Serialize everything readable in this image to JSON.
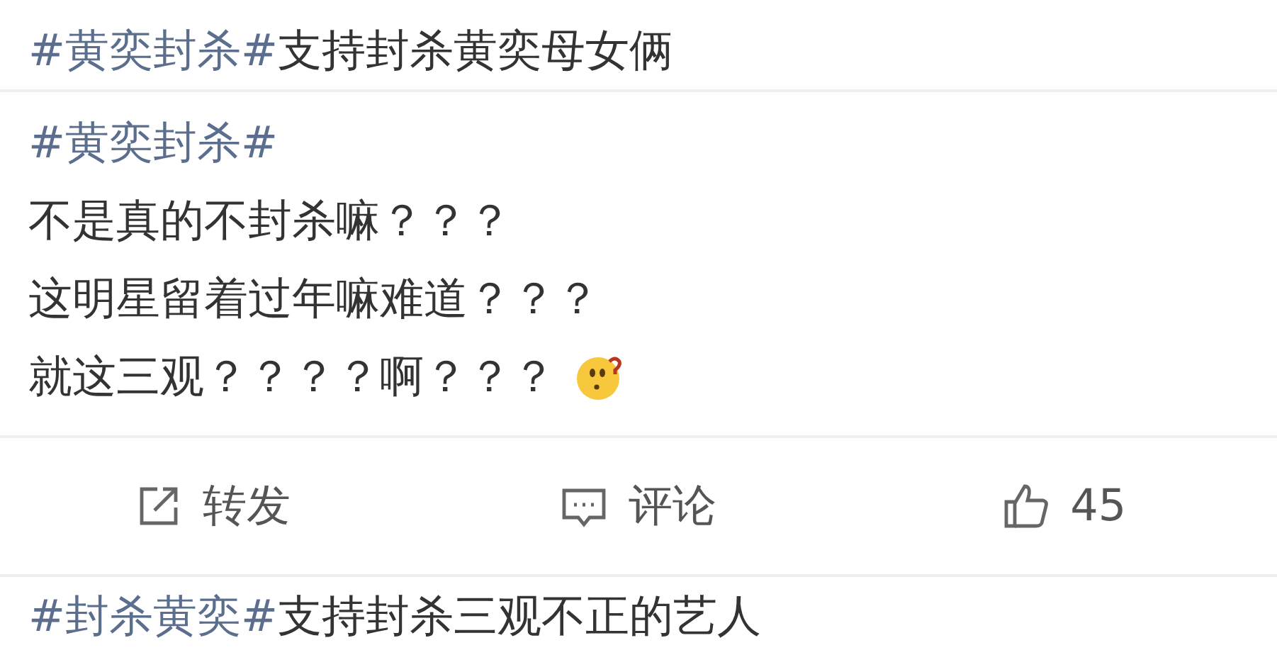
{
  "posts": [
    {
      "lines": [
        [
          {
            "kind": "hashtag",
            "text": "#黄奕封杀#"
          },
          {
            "kind": "text",
            "text": "支持封杀黄奕母女俩"
          }
        ]
      ]
    },
    {
      "lines": [
        [
          {
            "kind": "hashtag",
            "text": "#黄奕封杀#"
          }
        ],
        [
          {
            "kind": "text",
            "text": "不是真的不封杀嘛？？？"
          }
        ],
        [
          {
            "kind": "text",
            "text": "这明星留着过年嘛难道？？？"
          }
        ],
        [
          {
            "kind": "text",
            "text": "就这三观？？？？啊？？？"
          },
          {
            "kind": "emoji"
          }
        ]
      ],
      "actions": [
        {
          "kind": "share",
          "label": "转发"
        },
        {
          "kind": "comment",
          "label": "评论"
        },
        {
          "kind": "like",
          "label": "45"
        }
      ]
    },
    {
      "lines": [
        [
          {
            "kind": "hashtag",
            "text": "#封杀黄奕#"
          },
          {
            "kind": "text",
            "text": "支持封杀三观不正的艺人"
          }
        ]
      ]
    }
  ]
}
